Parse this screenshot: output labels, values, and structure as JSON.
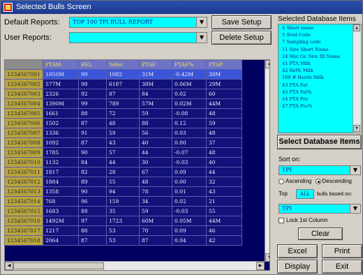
{
  "window": {
    "title": "Selected Bulls Screen"
  },
  "reports": {
    "default_label": "Default Reports:",
    "default_value": "TOP 100 TPI BULL REPORT",
    "user_label": "User Reports:",
    "user_value": "",
    "save_setup": "Save Setup",
    "delete_setup": "Delete Setup"
  },
  "grid": {
    "columns": [
      "PTAM",
      "REL",
      "%Rel",
      "PTAF",
      "PTAF%",
      "PTAP"
    ],
    "rows": [
      {
        "id": "1234567001",
        "cells": [
          "1050M",
          "99",
          "1082",
          "31M",
          "-0.42M",
          "38M"
        ]
      },
      {
        "id": "1234567002",
        "cells": [
          "577M",
          "98",
          "6187",
          "38M",
          "0.06M",
          "29M"
        ]
      },
      {
        "id": "1234567003",
        "cells": [
          "2326",
          "92",
          "87",
          "84",
          "0.02",
          "60"
        ]
      },
      {
        "id": "1234567004",
        "cells": [
          "1390M",
          "99",
          "789",
          "57M",
          "0.02M",
          "44M"
        ]
      },
      {
        "id": "1234567005",
        "cells": [
          "1661",
          "88",
          "72",
          "59",
          "-0.08",
          "48"
        ]
      },
      {
        "id": "1234567006",
        "cells": [
          "1502",
          "87",
          "48",
          "88",
          "0.12",
          "59"
        ]
      },
      {
        "id": "1234567007",
        "cells": [
          "1336",
          "91",
          "59",
          "56",
          "0.03",
          "48"
        ]
      },
      {
        "id": "1234567008",
        "cells": [
          "1092",
          "87",
          "43",
          "40",
          "0.00",
          "37"
        ]
      },
      {
        "id": "1234567009",
        "cells": [
          "1785",
          "90",
          "57",
          "44",
          "-0.07",
          "48"
        ]
      },
      {
        "id": "1234567010",
        "cells": [
          "1132",
          "84",
          "44",
          "30",
          "-0.03",
          "40"
        ]
      },
      {
        "id": "1234567011",
        "cells": [
          "1817",
          "82",
          "28",
          "67",
          "0.09",
          "44"
        ]
      },
      {
        "id": "1234567012",
        "cells": [
          "1884",
          "89",
          "55",
          "48",
          "0.00",
          "32"
        ]
      },
      {
        "id": "1234567013",
        "cells": [
          "1358",
          "90",
          "94",
          "78",
          "0.01",
          "43"
        ]
      },
      {
        "id": "1234567014",
        "cells": [
          "768",
          "96",
          "159",
          "34",
          "0.02",
          "21"
        ]
      },
      {
        "id": "1234567015",
        "cells": [
          "1683",
          "88",
          "35",
          "59",
          "-0.03",
          "55"
        ]
      },
      {
        "id": "1234567016",
        "cells": [
          "1492M",
          "97",
          "1723",
          "60M",
          "0.05M",
          "44M"
        ]
      },
      {
        "id": "1234567017",
        "cells": [
          "1217",
          "88",
          "53",
          "70",
          "0.09",
          "46"
        ]
      },
      {
        "id": "1234567018",
        "cells": [
          "2064",
          "87",
          "53",
          "87",
          "0.04",
          "42"
        ]
      }
    ]
  },
  "selected_db": {
    "label": "Selected Database Items",
    "items": [
      "4 Short name",
      "5 Stud Code",
      "7 Sampling code",
      "11 Sire Short Name",
      "24 Mat Gr. Sire ID Name",
      "41 PTA Milk",
      "42 Rel% Milk",
      "108 # Herds Milk",
      "43 PTA Fat",
      "45 PTA Fat%",
      "44 PTA Pro",
      "47 PTA Pro%"
    ],
    "select_button": "Select Database Items"
  },
  "sort": {
    "label": "Sort on:",
    "value": "TPI",
    "ascending": "Ascending",
    "descending": "Descending",
    "top_label": "Top",
    "top_value": "ALL",
    "based_on": "bulls based on:",
    "based_value": "TPI",
    "lock_label": "Lock 1st Column"
  },
  "buttons": {
    "clear": "Clear",
    "excel": "Excel",
    "print": "Print",
    "display": "Display",
    "exit": "Exit"
  }
}
